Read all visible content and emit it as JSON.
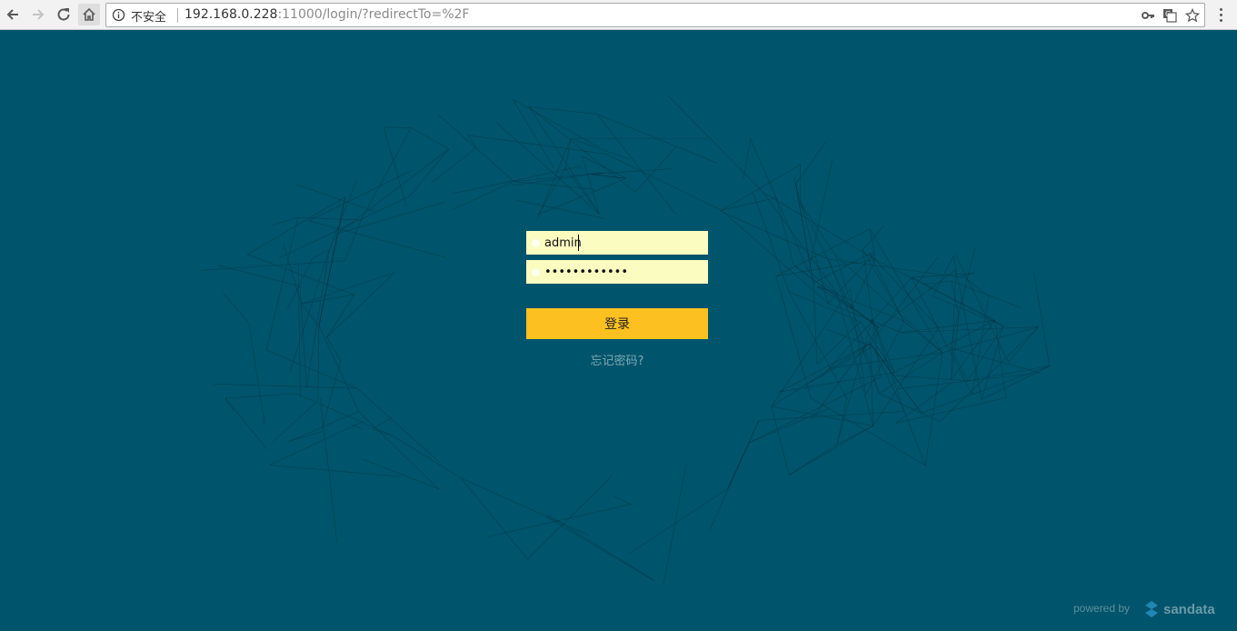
{
  "browser": {
    "security_label": "不安全",
    "url_host": "192.168.0.228",
    "url_rest": ":11000/login/?redirectTo=%2F",
    "icons": {
      "back": "back-arrow-icon",
      "forward": "forward-arrow-icon",
      "reload": "reload-icon",
      "home": "home-icon",
      "info": "info-icon",
      "key": "key-icon",
      "translate": "translate-icon",
      "bookmark": "star-icon",
      "menu": "kebab-menu-icon"
    }
  },
  "login": {
    "username_value": "admin",
    "password_value": "••••••••••••",
    "submit_label": "登录",
    "forgot_label": "忘记密码?"
  },
  "footer": {
    "powered_by": "powered by",
    "brand": "sandata"
  },
  "colors": {
    "background": "#00546b",
    "field": "#fafcc0",
    "button": "#fcc120",
    "link": "#7fa9b4"
  }
}
